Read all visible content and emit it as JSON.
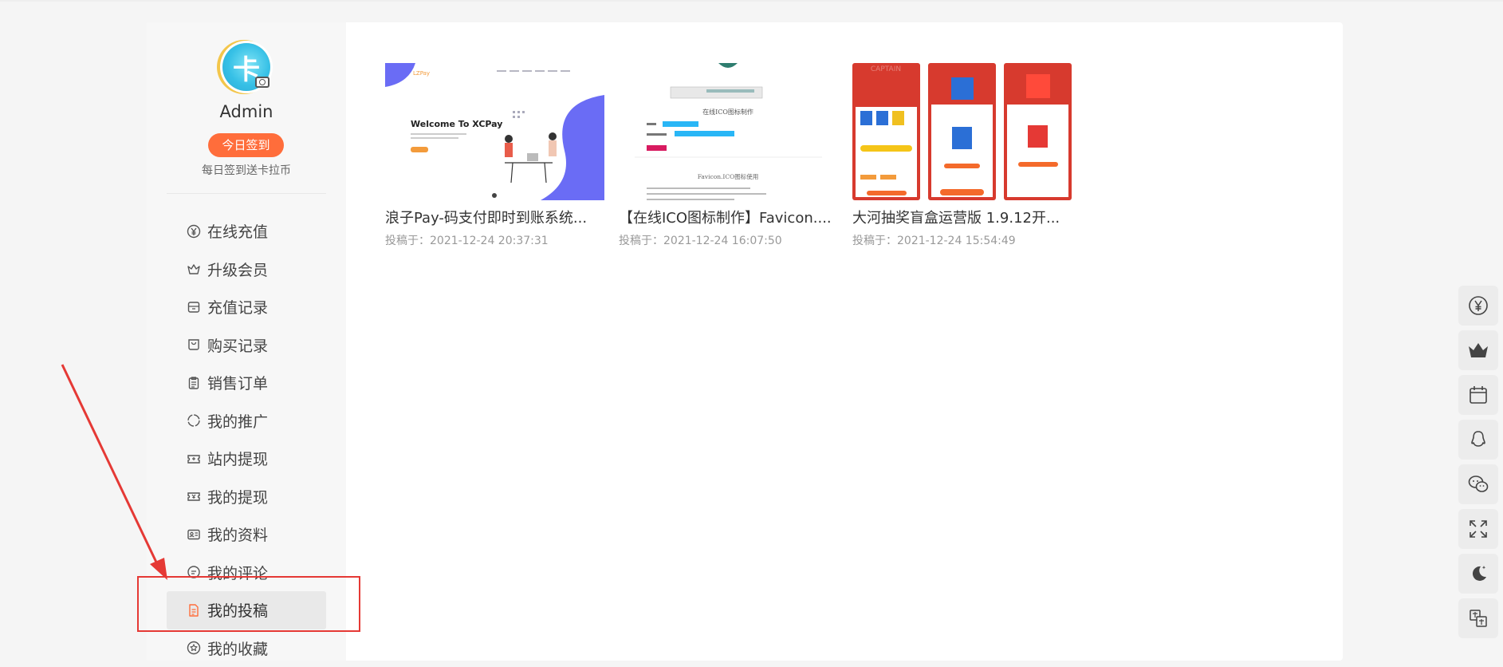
{
  "user": {
    "name": "Admin",
    "avatar_char": "卡",
    "checkin_label": "今日签到",
    "checkin_sub": "每日签到送卡拉币"
  },
  "menu": [
    {
      "label": "在线充值",
      "icon": "yen-icon"
    },
    {
      "label": "升级会员",
      "icon": "crown-icon"
    },
    {
      "label": "充值记录",
      "icon": "wallet-icon"
    },
    {
      "label": "购买记录",
      "icon": "bag-icon"
    },
    {
      "label": "销售订单",
      "icon": "clipboard-icon"
    },
    {
      "label": "我的推广",
      "icon": "loop-icon"
    },
    {
      "label": "站内提现",
      "icon": "ticket-icon"
    },
    {
      "label": "我的提现",
      "icon": "yen-ticket-icon"
    },
    {
      "label": "我的资料",
      "icon": "id-card-icon"
    },
    {
      "label": "我的评论",
      "icon": "comment-icon"
    },
    {
      "label": "我的投稿",
      "icon": "document-icon",
      "active": true
    },
    {
      "label": "我的收藏",
      "icon": "star-icon"
    }
  ],
  "posts": [
    {
      "title": "浪子Pay-码支付即时到账系统...",
      "date": "投稿于：2021-12-24 20:37:31",
      "thumb_heading": "Welcome To XCPay",
      "thumb_logo": "LZPay"
    },
    {
      "title": "【在线ICO图标制作】Favicon....",
      "date": "投稿于：2021-12-24 16:07:50",
      "thumb_heading": "在线ICO图标制作",
      "thumb_sub": "Favicon.ICO图标使用"
    },
    {
      "title": "大河抽奖盲盒运营版 1.9.12开...",
      "date": "投稿于：2021-12-24 15:54:49",
      "thumb_heading": "CAPTAIN"
    }
  ],
  "right_toolbar": [
    "yen-icon",
    "crown-icon",
    "calendar-icon",
    "qq-icon",
    "wechat-icon",
    "fullscreen-icon",
    "moon-icon",
    "translate-icon"
  ],
  "colors": {
    "accent": "#ff6d3b",
    "highlight_box": "#e53935",
    "arrow": "#e53935"
  }
}
